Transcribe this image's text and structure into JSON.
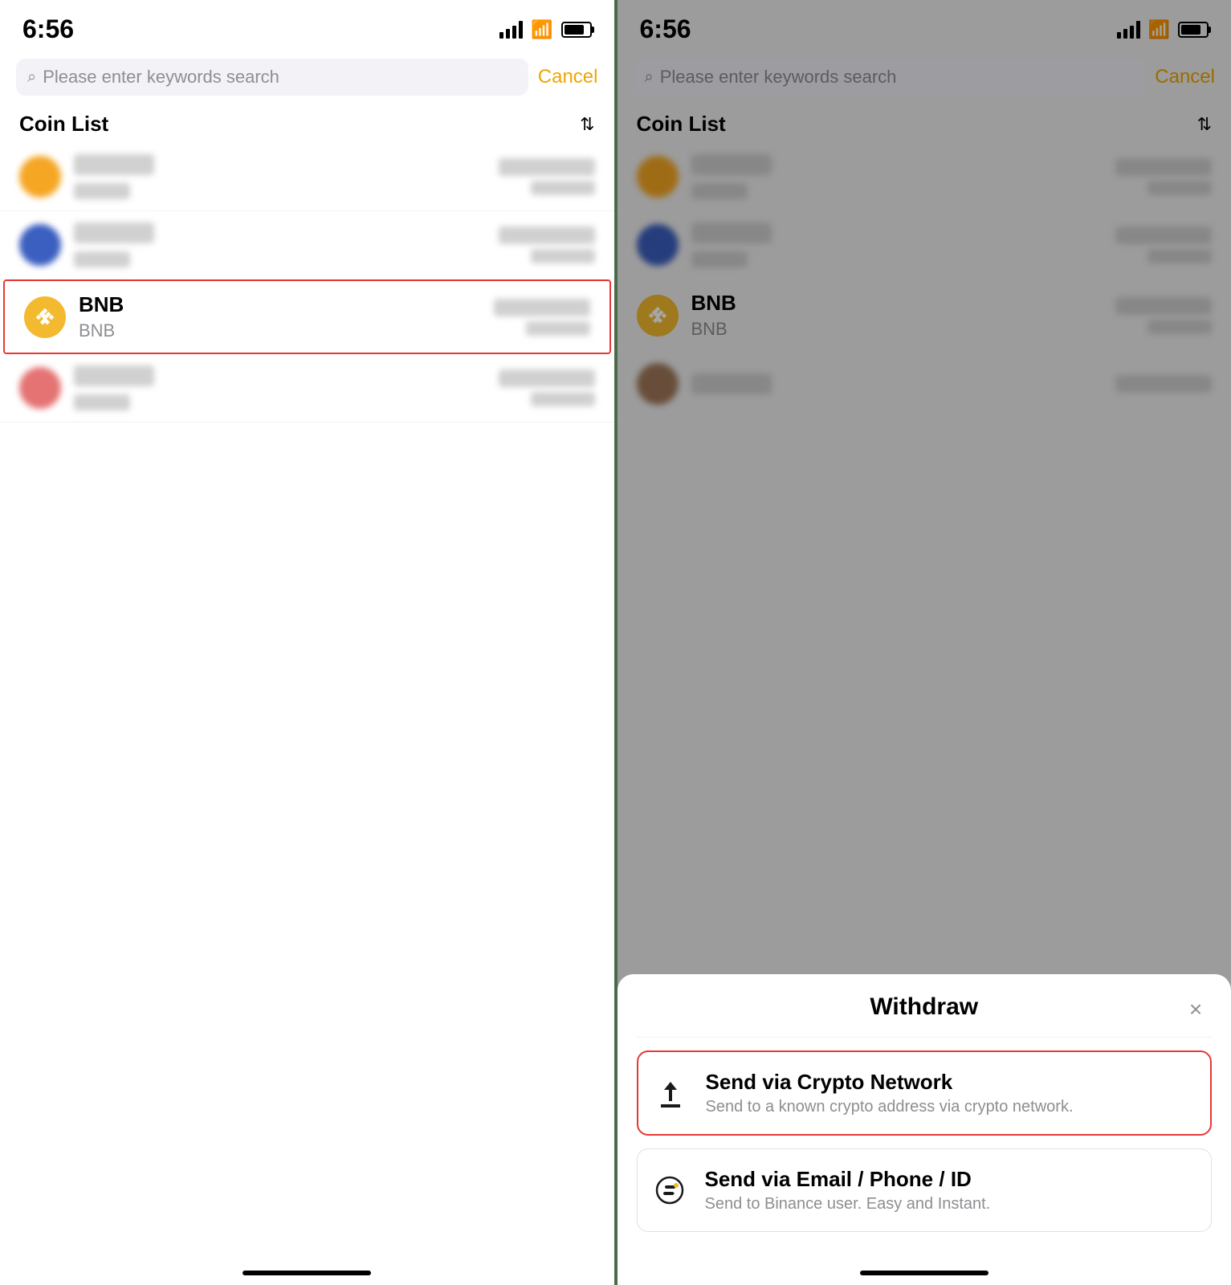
{
  "left_panel": {
    "status": {
      "time": "6:56"
    },
    "search": {
      "placeholder": "Please enter keywords search",
      "cancel_label": "Cancel"
    },
    "coin_list": {
      "title": "Coin List",
      "sort_icon": "↕",
      "items": [
        {
          "id": "coin1",
          "type": "blurred",
          "icon_color": "orange"
        },
        {
          "id": "coin2",
          "type": "blurred",
          "icon_color": "blue"
        },
        {
          "id": "bnb",
          "type": "bnb",
          "name": "BNB",
          "symbol": "BNB",
          "highlighted": true
        },
        {
          "id": "coin4",
          "type": "blurred",
          "icon_color": "pink"
        }
      ]
    }
  },
  "right_panel": {
    "status": {
      "time": "6:56"
    },
    "search": {
      "placeholder": "Please enter keywords search",
      "cancel_label": "Cancel"
    },
    "coin_list": {
      "title": "Coin List"
    },
    "withdraw_sheet": {
      "title": "Withdraw",
      "close_label": "×",
      "options": [
        {
          "id": "crypto-network",
          "title": "Send via Crypto Network",
          "description": "Send to a known crypto address via crypto network.",
          "highlighted": true,
          "icon": "upload"
        },
        {
          "id": "email-phone",
          "title": "Send via Email / Phone / ID",
          "description": "Send to Binance user. Easy and Instant.",
          "highlighted": false,
          "icon": "tag"
        }
      ]
    }
  }
}
